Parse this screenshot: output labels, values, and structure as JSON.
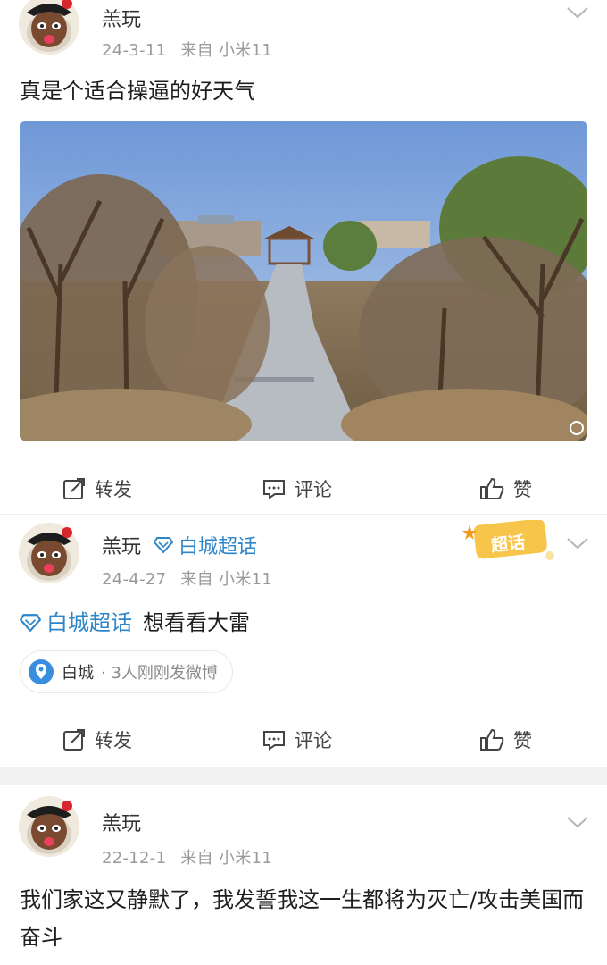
{
  "posts": [
    {
      "user": "羔玩",
      "date": "24-3-11",
      "source": "来自 小米11",
      "text": "真是个适合操逼的好天气",
      "actions": {
        "repost": "转发",
        "comment": "评论",
        "like": "赞"
      }
    },
    {
      "user": "羔玩",
      "topic": "白城超话",
      "badge": "超话",
      "date": "24-4-27",
      "source": "来自 小米11",
      "text_topic": "白城超话",
      "text": "想看看大雷",
      "location": {
        "city": "白城",
        "sub": "· 3人刚刚发微博"
      },
      "actions": {
        "repost": "转发",
        "comment": "评论",
        "like": "赞"
      }
    },
    {
      "user": "羔玩",
      "date": "22-12-1",
      "source": "来自 小米11",
      "text": "我们家这又静默了，我发誓我这一生都将为灭亡/攻击美国而奋斗"
    }
  ],
  "colors": {
    "accent": "#2e86c9",
    "meta": "#9a9a9a",
    "badge": "#f6c54a"
  },
  "icons": [
    "avatar-icon",
    "chevron-down-icon",
    "repost-icon",
    "comment-icon",
    "like-icon",
    "diamond-icon",
    "location-pin-icon",
    "weibo-watermark-icon"
  ]
}
